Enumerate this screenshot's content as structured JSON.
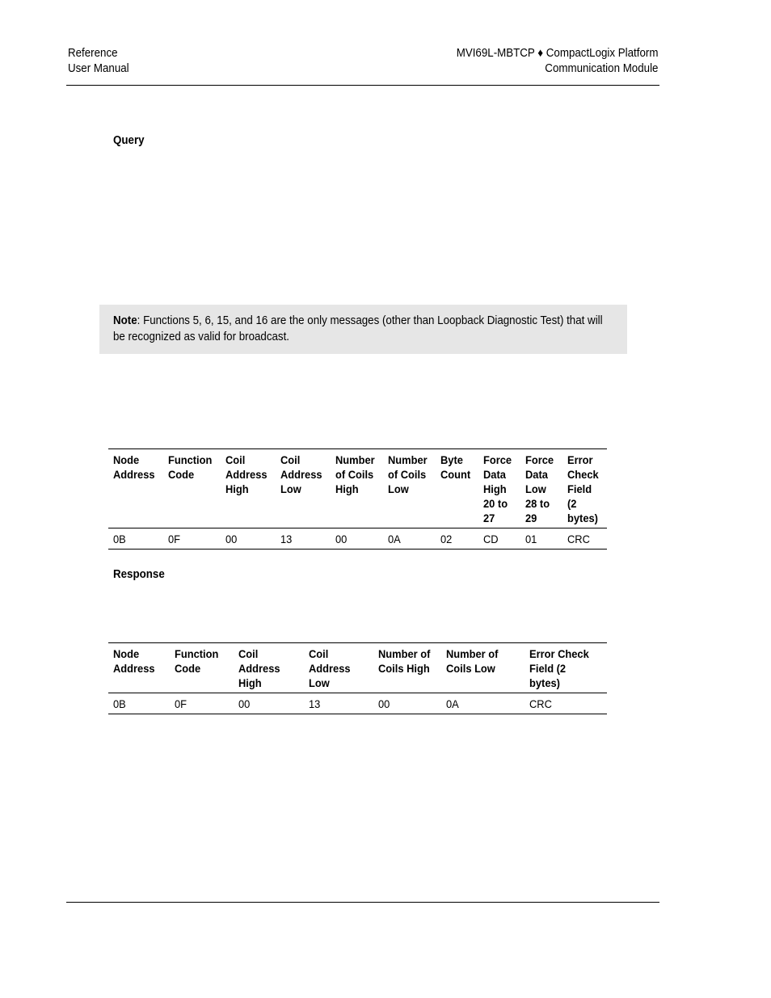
{
  "header": {
    "left_line1": "Reference",
    "left_line2": "User Manual",
    "right_line1": "MVI69L-MBTCP ♦ CompactLogix Platform",
    "right_line2": "Communication Module"
  },
  "query_heading": "Query",
  "note": {
    "label": "Note",
    "text": ": Functions 5, 6, 15, and 16 are the only messages (other than Loopback Diagnostic Test) that will be recognized as valid for broadcast."
  },
  "query_table": {
    "headers": [
      "Node Address",
      "Function Code",
      "Coil Address High",
      "Coil Address Low",
      "Number of Coils High",
      "Number of Coils Low",
      "Byte Count",
      "Force Data High 20 to 27",
      "Force Data Low 28 to 29",
      "Error Check Field (2 bytes)"
    ],
    "rows": [
      [
        "0B",
        "0F",
        "00",
        "13",
        "00",
        "0A",
        "02",
        "CD",
        "01",
        "CRC"
      ]
    ]
  },
  "response_heading": "Response",
  "response_table": {
    "headers": [
      "Node Address",
      "Function Code",
      "Coil Address High",
      "Coil Address Low",
      "Number of Coils High",
      "Number of Coils Low",
      "Error Check Field (2 bytes)"
    ],
    "rows": [
      [
        "0B",
        "0F",
        "00",
        "13",
        "00",
        "0A",
        "CRC"
      ]
    ]
  }
}
